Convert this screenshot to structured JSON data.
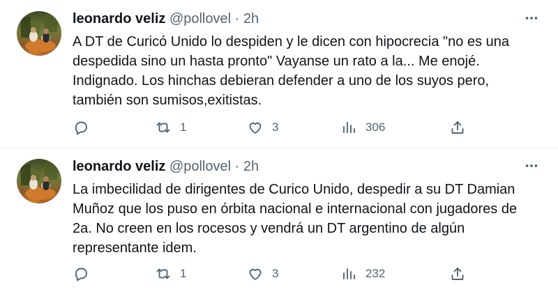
{
  "tweets": [
    {
      "author_name": "leonardo veliz",
      "handle": "@pollovel",
      "time": "2h",
      "text": "A DT de Curicó Unido lo despiden y le dicen con hipocrecia \"no es una despedida sino un hasta pronto\" Vayanse un rato a la... Me enojé. Indignado. Los hinchas debieran defender a uno de los suyos pero, también son sumisos,exitistas.",
      "retweets": "1",
      "likes": "3",
      "views": "306"
    },
    {
      "author_name": "leonardo veliz",
      "handle": "@pollovel",
      "time": "2h",
      "text": "La imbecilidad de dirigentes de Curico Unido, despedir a su DT Damian Muñoz que los puso en órbita nacional e internacional con jugadores de 2a. No creen en los rocesos y vendrá un DT argentino de algún representante idem.",
      "retweets": "1",
      "likes": "3",
      "views": "232"
    }
  ],
  "icons": {
    "reply": "reply-icon",
    "retweet": "retweet-icon",
    "like": "heart-icon",
    "views": "views-icon",
    "share": "share-icon",
    "more": "more-icon"
  },
  "colors": {
    "text": "#0f1419",
    "secondary": "#536471",
    "divider": "#eff3f4"
  }
}
